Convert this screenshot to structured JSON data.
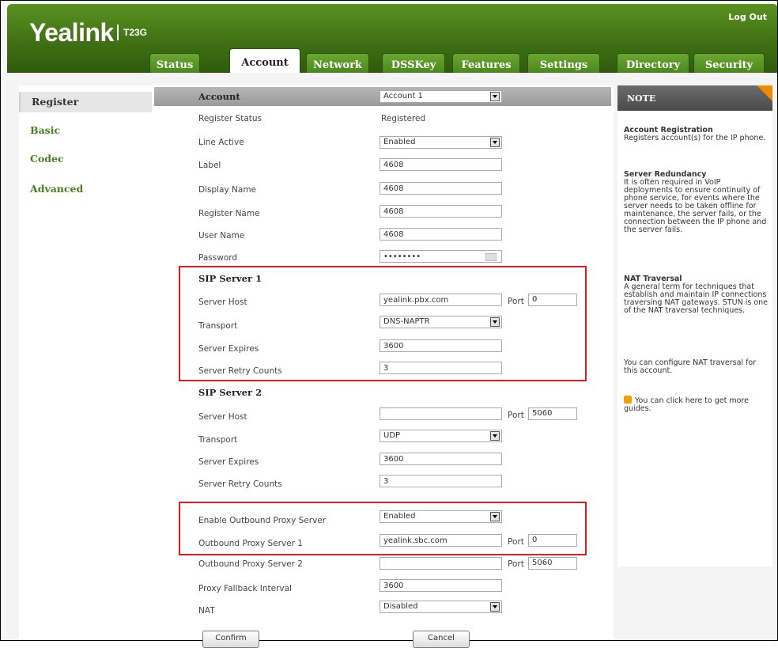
{
  "header": {
    "brand": "Yealink",
    "model": "T23G",
    "logout_label": "Log Out"
  },
  "tabs": [
    {
      "label": "Status",
      "active": false
    },
    {
      "label": "Account",
      "active": true
    },
    {
      "label": "Network",
      "active": false
    },
    {
      "label": "DSSKey",
      "active": false
    },
    {
      "label": "Features",
      "active": false
    },
    {
      "label": "Settings",
      "active": false
    },
    {
      "label": "Directory",
      "active": false
    },
    {
      "label": "Security",
      "active": false
    }
  ],
  "sidebar": {
    "items": [
      {
        "label": "Register",
        "active": true
      },
      {
        "label": "Basic",
        "active": false
      },
      {
        "label": "Codec",
        "active": false
      },
      {
        "label": "Advanced",
        "active": false
      }
    ]
  },
  "form": {
    "account_label": "Account",
    "account_value": "Account 1",
    "register_status_label": "Register Status",
    "register_status_value": "Registered",
    "line_active_label": "Line Active",
    "line_active_value": "Enabled",
    "label_label": "Label",
    "label_value": "4608",
    "display_name_label": "Display Name",
    "display_name_value": "4608",
    "register_name_label": "Register Name",
    "register_name_value": "4608",
    "user_name_label": "User Name",
    "user_name_value": "4608",
    "password_label": "Password",
    "password_value": "••••••••",
    "sip1": {
      "title": "SIP Server 1",
      "server_host_label": "Server Host",
      "server_host_value": "yealink.pbx.com",
      "port_label": "Port",
      "port_value": "0",
      "transport_label": "Transport",
      "transport_value": "DNS-NAPTR",
      "server_expires_label": "Server Expires",
      "server_expires_value": "3600",
      "retry_label": "Server Retry Counts",
      "retry_value": "3"
    },
    "sip2": {
      "title": "SIP Server 2",
      "server_host_label": "Server Host",
      "server_host_value": "",
      "port_label": "Port",
      "port_value": "5060",
      "transport_label": "Transport",
      "transport_value": "UDP",
      "server_expires_label": "Server Expires",
      "server_expires_value": "3600",
      "retry_label": "Server Retry Counts",
      "retry_value": "3"
    },
    "outbound_enable_label": "Enable Outbound Proxy Server",
    "outbound_enable_value": "Enabled",
    "outbound1_label": "Outbound Proxy Server 1",
    "outbound1_value": "yealink.sbc.com",
    "outbound1_port_label": "Port",
    "outbound1_port_value": "0",
    "outbound2_label": "Outbound Proxy Server 2",
    "outbound2_value": "",
    "outbound2_port_label": "Port",
    "outbound2_port_value": "5060",
    "fallback_label": "Proxy Fallback Interval",
    "fallback_value": "3600",
    "nat_label": "NAT",
    "nat_value": "Disabled",
    "confirm_label": "Confirm",
    "cancel_label": "Cancel"
  },
  "note": {
    "header": "NOTE",
    "s1_title": "Account Registration",
    "s1_body": "Registers account(s) for the IP phone.",
    "s2_title": "Server Redundancy",
    "s2_body": "It is often required in VoIP deployments to ensure continuity of phone service, for events where the server needs to be taken offline for maintenance, the server fails, or the connection between the IP phone and the server fails.",
    "s3_title": "NAT Traversal",
    "s3_body": "A general term for techniques that establish and maintain IP connections traversing NAT gateways. STUN is one of the NAT traversal techniques.",
    "s4_body": "You can configure NAT traversal for this account.",
    "guide_text": "You can click here to get more guides."
  },
  "colors": {
    "brand_green": "#46801b",
    "highlight_red": "#d62020",
    "note_accent": "#f08a00"
  }
}
